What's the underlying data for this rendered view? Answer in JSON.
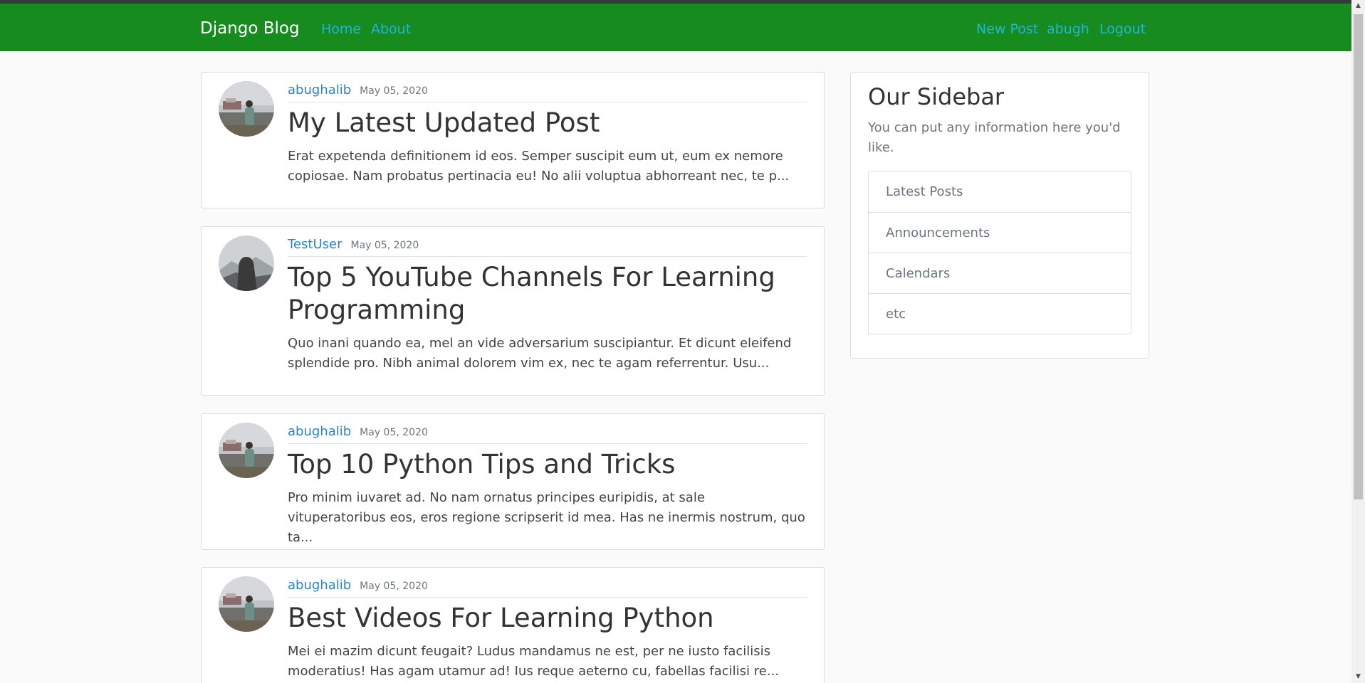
{
  "navbar": {
    "brand": "Django Blog",
    "left_links": [
      "Home",
      "About"
    ],
    "right_links": [
      "New Post",
      "abugh",
      "Logout"
    ],
    "background_color": "#178b1e",
    "link_color": "#23b5d8"
  },
  "posts": [
    {
      "author": "abughalib",
      "date": "May 05, 2020",
      "title": "My Latest Updated Post",
      "excerpt": "Erat expetenda definitionem id eos. Semper suscipit eum ut, eum ex nemore copiosae. Nam probatus pertinacia eu! No alii voluptua abhorreant nec, te p...",
      "avatar": "person-by-lake-photo"
    },
    {
      "author": "TestUser",
      "date": "May 05, 2020",
      "title": "Top 5 YouTube Channels For Learning Programming",
      "excerpt": "Quo inani quando ea, mel an vide adversarium suscipiantur. Et dicunt eleifend splendide pro. Nibh animal dolorem vim ex, nec te agam referrentur. Usu...",
      "avatar": "hooded-figure-mountain-photo"
    },
    {
      "author": "abughalib",
      "date": "May 05, 2020",
      "title": "Top 10 Python Tips and Tricks",
      "excerpt": "Pro minim iuvaret ad. No nam ornatus principes euripidis, at sale vituperatoribus eos, eros regione scripserit id mea. Has ne inermis nostrum, quo ta...",
      "avatar": "person-by-lake-photo"
    },
    {
      "author": "abughalib",
      "date": "May 05, 2020",
      "title": "Best Videos For Learning Python",
      "excerpt": "Mei ei mazim dicunt feugait? Ludus mandamus ne est, per ne iusto facilisis moderatius! Has agam utamur ad! Ius reque aeterno cu, fabellas facilisi re...",
      "avatar": "person-by-lake-photo"
    }
  ],
  "sidebar": {
    "title": "Our Sidebar",
    "description": "You can put any information here you'd like.",
    "items": [
      "Latest Posts",
      "Announcements",
      "Calendars",
      "etc"
    ]
  },
  "icons": {
    "scroll_up": "scroll-up-arrow-icon",
    "scroll_down": "scroll-down-arrow-icon"
  }
}
